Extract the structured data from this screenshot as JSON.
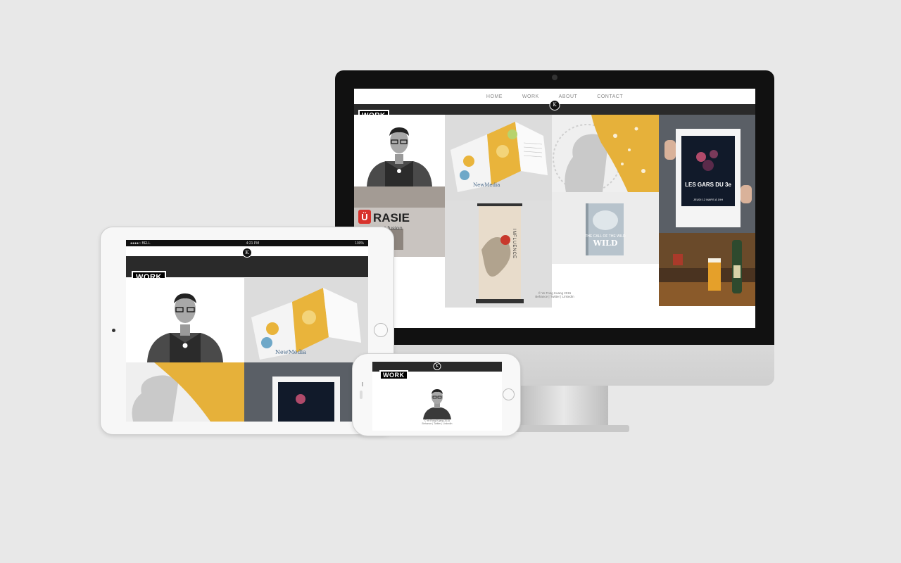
{
  "nav": {
    "items": [
      {
        "label": "HOME"
      },
      {
        "label": "WORK"
      },
      {
        "label": "ABOUT"
      },
      {
        "label": "CONTACT"
      }
    ]
  },
  "logo": {
    "mark": "K"
  },
  "section": {
    "label": "WORK"
  },
  "tiles": {
    "rasie_title": "RASIE",
    "rasie_sub": "ant fusion",
    "brochure_brand": "NewMedia",
    "book_title": "THE CALL OF THE WILD",
    "poster_title": "LES GARS DU 3e",
    "poster_date": "JEUDI 12 MARS À 19H",
    "banner_text": "INFLUENCE"
  },
  "footer": {
    "line1": "© Ye Fong Kuang 2015",
    "line2": "Behance | Twitter | LinkedIn"
  },
  "status_bar": {
    "carrier": "●●●●○ BELL",
    "time": "4:21 PM",
    "battery": "100%"
  },
  "colors": {
    "background": "#e8e8e8",
    "accent_yellow": "#e8b23a",
    "rasie_red": "#d8322c",
    "bezel": "#111111"
  }
}
